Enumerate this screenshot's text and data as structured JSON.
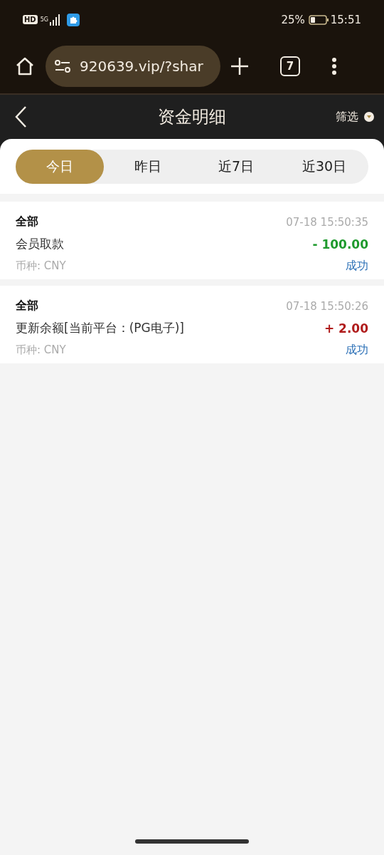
{
  "status_bar": {
    "hd_badge": "HD",
    "network": "5G",
    "battery_percent": "25%",
    "time": "15:51"
  },
  "browser": {
    "url": "920639.vip/?shar",
    "tab_count": "7"
  },
  "header": {
    "title": "资金明细",
    "filter": "筛选"
  },
  "tabs": [
    {
      "label": "今日",
      "selected": true
    },
    {
      "label": "昨日",
      "selected": false
    },
    {
      "label": "近7日",
      "selected": false
    },
    {
      "label": "近30日",
      "selected": false
    }
  ],
  "records": [
    {
      "category": "全部",
      "time": "07-18 15:50:35",
      "description": "会员取款",
      "amount": "- 100.00",
      "kind": "debit",
      "currency": "币种: CNY",
      "status": "成功"
    },
    {
      "category": "全部",
      "time": "07-18 15:50:26",
      "description": "更新余额[当前平台：(PG电子)]",
      "amount": "+ 2.00",
      "kind": "credit",
      "currency": "币种: CNY",
      "status": "成功"
    }
  ]
}
